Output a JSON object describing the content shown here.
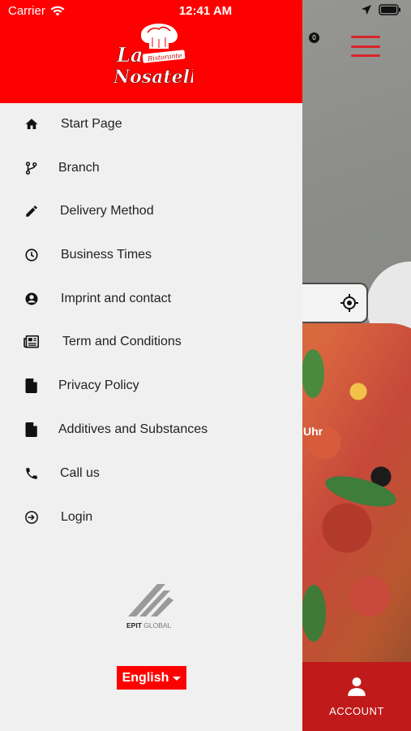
{
  "status_bar": {
    "carrier": "Carrier",
    "time": "12:41 AM"
  },
  "header": {
    "logo_alt": "La Nosatella Ristorante",
    "logo_line1": "La",
    "logo_line2": "Nosatella",
    "logo_ristorante": "Ristorante"
  },
  "background": {
    "cart_count": "0",
    "partial_text": "Uhr",
    "account_label": "ACCOUNT"
  },
  "menu": {
    "items": [
      {
        "label": "Start Page",
        "icon": "home-icon"
      },
      {
        "label": "Branch",
        "icon": "branch-icon"
      },
      {
        "label": "Delivery Method",
        "icon": "pencil-icon"
      },
      {
        "label": "Business Times",
        "icon": "clock-icon"
      },
      {
        "label": "Imprint and contact",
        "icon": "account-circle-icon"
      },
      {
        "label": "Term and Conditions",
        "icon": "newspaper-icon"
      },
      {
        "label": "Privacy Policy",
        "icon": "document-icon"
      },
      {
        "label": "Additives and Substances",
        "icon": "document-icon"
      },
      {
        "label": "Call us",
        "icon": "phone-icon"
      },
      {
        "label": "Login",
        "icon": "login-icon"
      }
    ]
  },
  "footer": {
    "brand": "EPIT GLOBAL",
    "language": "English"
  },
  "colors": {
    "header_red": "#ff0000",
    "account_red": "#c11a1a",
    "drawer_bg": "#f0f0f0"
  }
}
